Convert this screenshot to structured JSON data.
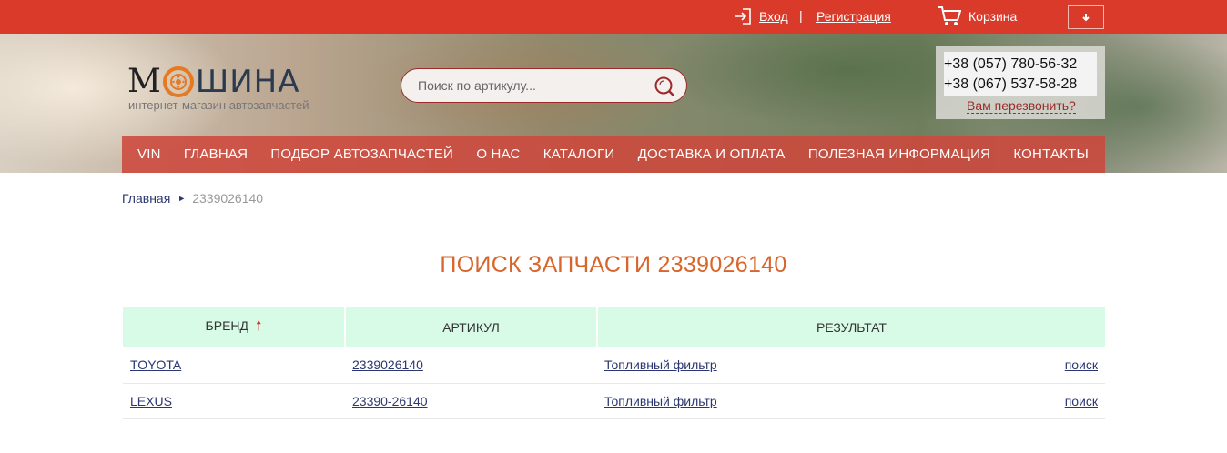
{
  "topbar": {
    "login_label": "Вход",
    "separator": "|",
    "register_label": "Регистрация",
    "cart_label": "Корзина",
    "dropdown_icon": "arrow-down-icon"
  },
  "header": {
    "logo_m": "М",
    "logo_shina": "ШИНА",
    "logo_subtitle": "интернет-магазин автозапчастей",
    "search_placeholder": "Поиск по артикулу...",
    "phone1": "+38 (057) 780-56-32",
    "phone2": "+38 (067) 537-58-28",
    "callback_label": "Вам перезвонить?"
  },
  "nav": {
    "items": [
      {
        "label": "VIN"
      },
      {
        "label": "ГЛАВНАЯ"
      },
      {
        "label": "ПОДБОР АВТОЗАПЧАСТЕЙ"
      },
      {
        "label": "О НАС"
      },
      {
        "label": "КАТАЛОГИ"
      },
      {
        "label": "ДОСТАВКА И ОПЛАТА"
      },
      {
        "label": "ПОЛЕЗНАЯ ИНФОРМАЦИЯ"
      },
      {
        "label": "КОНТАКТЫ"
      }
    ]
  },
  "breadcrumb": {
    "home": "Главная",
    "arrow": "►",
    "current": "2339026140"
  },
  "page_title": "ПОИСК ЗАПЧАСТИ 2339026140",
  "table": {
    "headers": {
      "brand": "БРЕНД",
      "article": "АРТИКУЛ",
      "result": "РЕЗУЛЬТАТ",
      "sort_arrow": "🠕"
    },
    "rows": [
      {
        "brand": "TOYOTA",
        "article": "2339026140",
        "result": "Топливный фильтр",
        "action": "поиск"
      },
      {
        "brand": "LEXUS",
        "article": "23390-26140",
        "result": "Топливный фильтр",
        "action": "поиск"
      }
    ]
  },
  "colors": {
    "topbar": "#d93a2a",
    "nav": "#cd483c",
    "title": "#d9652b",
    "table_header": "#d8fbe8",
    "link": "#2b3770"
  }
}
